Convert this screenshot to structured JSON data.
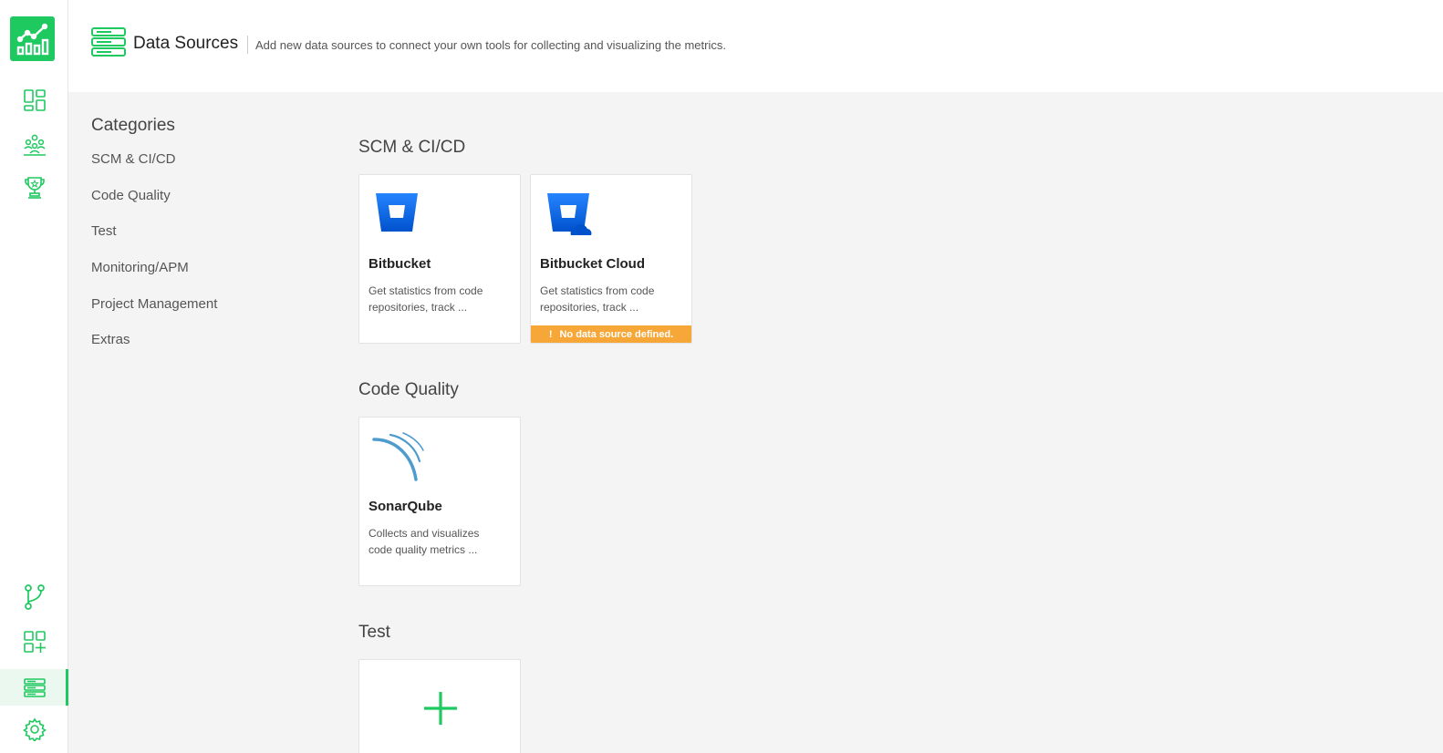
{
  "header": {
    "title": "Data Sources",
    "description": "Add new data sources to connect your own tools for collecting and visualizing the metrics."
  },
  "sidebar": {
    "icons": [
      "dashboard-icon",
      "teams-icon",
      "trophy-icon",
      "branch-icon",
      "add-widget-icon",
      "data-sources-icon",
      "settings-icon"
    ],
    "active": "data-sources-icon"
  },
  "categories": {
    "title": "Categories",
    "items": [
      "SCM & CI/CD",
      "Code Quality",
      "Test",
      "Monitoring/APM",
      "Project Management",
      "Extras"
    ]
  },
  "sections": [
    {
      "title": "SCM & CI/CD",
      "cards": [
        {
          "name": "Bitbucket",
          "description": "Get statistics from code repositories, track ...",
          "icon": "bitbucket-icon"
        },
        {
          "name": "Bitbucket Cloud",
          "description": "Get statistics from code repositories, track ...",
          "icon": "bitbucket-cloud-icon",
          "warning": "No data source defined."
        }
      ]
    },
    {
      "title": "Code Quality",
      "cards": [
        {
          "name": "SonarQube",
          "description": "Collects and visualizes code quality metrics ...",
          "icon": "sonarqube-icon"
        }
      ]
    },
    {
      "title": "Test",
      "cards": [
        {
          "name": "",
          "description": "",
          "icon": "add-icon"
        }
      ]
    }
  ],
  "colors": {
    "accent": "#1ec95f",
    "warning": "#f7a737",
    "bitbucket": "#2684ff"
  }
}
